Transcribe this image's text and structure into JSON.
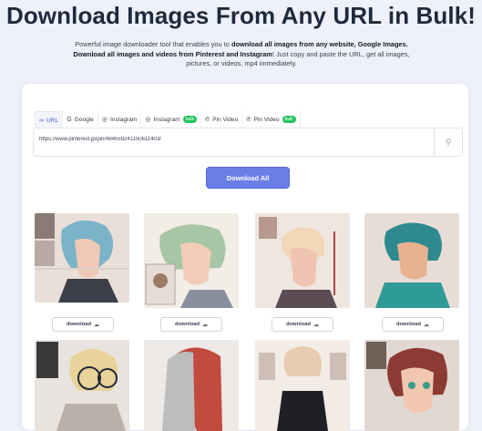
{
  "hero": {
    "title": "Download Images From Any URL in Bulk!",
    "sub_1": "Powerful image downloader tool that enables you to ",
    "sub_b1": "download all images from any website, Google Images. Download all images and videos from Pinterest and Instagram",
    "sub_2": "! Just copy and paste the URL, get all images, pictures, or videos, mp4 immediately."
  },
  "tabs": [
    {
      "icon": "∞",
      "label": "URL",
      "badge": ""
    },
    {
      "icon": "G",
      "label": "Google",
      "badge": ""
    },
    {
      "icon": "◎",
      "label": "Instagram",
      "badge": ""
    },
    {
      "icon": "◎",
      "label": "Instagram",
      "badge": "bulk"
    },
    {
      "icon": "℗",
      "label": "Pin Video",
      "badge": ""
    },
    {
      "icon": "℗",
      "label": "Pin Video",
      "badge": "bulk"
    }
  ],
  "url_input": {
    "value": "https://www.pinterest.jp/pin/484559241150611403/"
  },
  "download_all_label": "Download All",
  "download_label": "download",
  "colors": {
    "accent": "#6b7ee8",
    "badge": "#22c55e",
    "title": "#1f2a3c"
  }
}
